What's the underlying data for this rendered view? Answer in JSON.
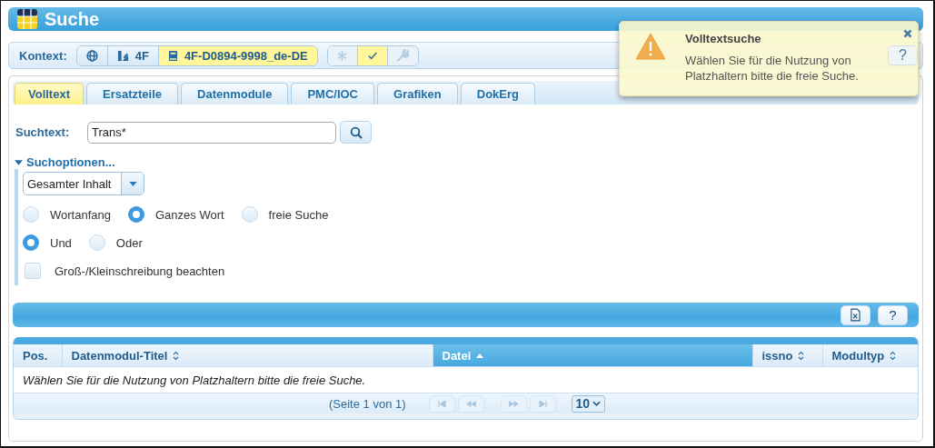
{
  "window": {
    "title": "Suche"
  },
  "context": {
    "label": "Kontext:",
    "items": [
      {
        "selected": false
      },
      {
        "label": "4F",
        "selected": false
      },
      {
        "label": "4F-D0894-9998_de-DE",
        "selected": true
      }
    ],
    "actions": [
      {
        "selected": false,
        "disabled": true
      },
      {
        "selected": true,
        "disabled": false
      },
      {
        "selected": false,
        "disabled": true
      }
    ],
    "help": "?"
  },
  "tabs": [
    {
      "label": "Volltext",
      "selected": true
    },
    {
      "label": "Ersatzteile",
      "selected": false
    },
    {
      "label": "Datenmodule",
      "selected": false
    },
    {
      "label": "PMC/IOC",
      "selected": false
    },
    {
      "label": "Grafiken",
      "selected": false
    },
    {
      "label": "DokErg",
      "selected": false
    }
  ],
  "search": {
    "label": "Suchtext:",
    "value": "Trans*"
  },
  "options": {
    "toggle": "Suchoptionen...",
    "expanded": true,
    "scope": "Gesamter Inhalt",
    "radio_groups": [
      [
        {
          "label": "Wortanfang",
          "selected": false
        },
        {
          "label": "Ganzes Wort",
          "selected": true
        },
        {
          "label": "freie Suche",
          "selected": false
        }
      ],
      [
        {
          "label": "Und",
          "selected": true
        },
        {
          "label": "Oder",
          "selected": false
        }
      ]
    ],
    "case_sensitive": {
      "label": "Groß-/Kleinschreibung beachten",
      "checked": false
    }
  },
  "toolbar": {
    "help": "?"
  },
  "table": {
    "columns": [
      {
        "label": "Pos.",
        "sortable": false,
        "selected": false
      },
      {
        "label": "Datenmodul-Titel",
        "sortable": true,
        "selected": false
      },
      {
        "label": "Datei",
        "sortable": true,
        "selected": true
      },
      {
        "label": "issno",
        "sortable": true,
        "selected": false
      },
      {
        "label": "Modultyp",
        "sortable": true,
        "selected": false
      }
    ],
    "empty_message": "Wählen Sie für die Nutzung von Platzhaltern bitte die freie Suche.",
    "pager": {
      "info": "(Seite 1 von 1)",
      "page_size": "10"
    }
  },
  "toast": {
    "title": "Volltextsuche",
    "message": "Wählen Sie für die Nutzung von Platzhaltern bitte die freie Suche."
  }
}
